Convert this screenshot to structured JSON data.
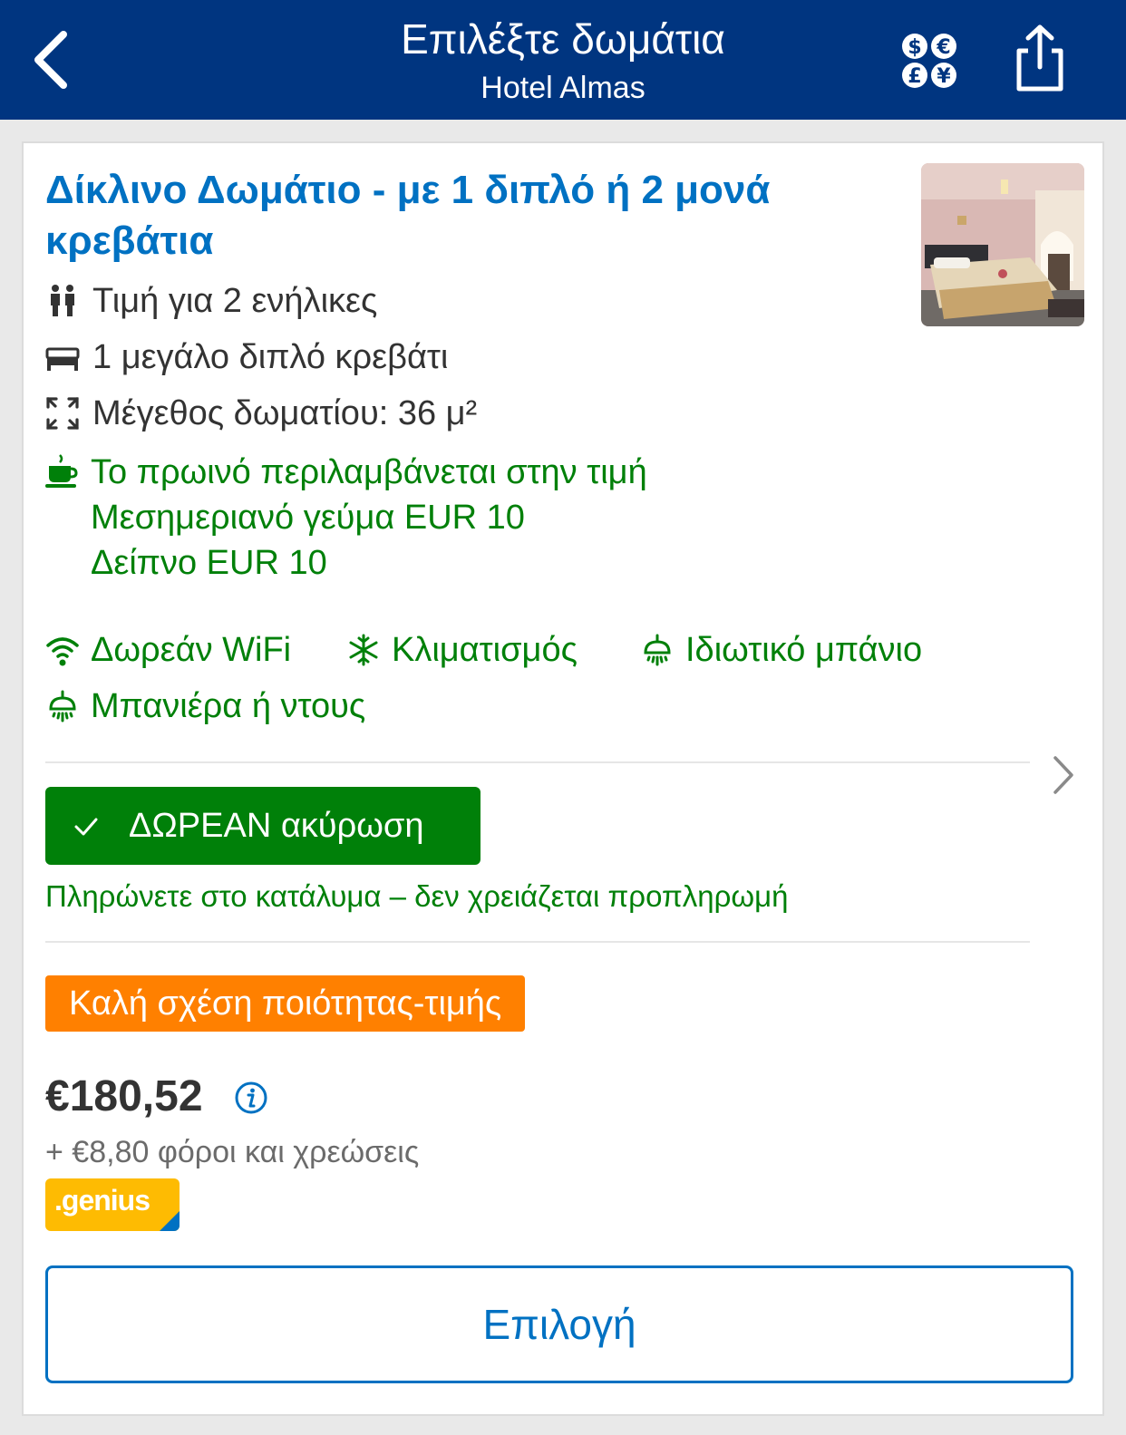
{
  "header": {
    "title": "Επιλέξτε δωμάτια",
    "subtitle": "Hotel Almas",
    "back_icon": "chevron-left-icon",
    "currency_icon": "currency-icon",
    "share_icon": "share-icon"
  },
  "room": {
    "title": "Δίκλινο Δωμάτιο - με 1 διπλό ή 2 μονά κρεβάτια",
    "occupancy": "Τιμή για 2 ενήλικες",
    "bed": "1 μεγάλο διπλό κρεβάτι",
    "size": "Μέγεθος δωματίου: 36 μ²",
    "meals": [
      "Το πρωινό περιλαμβάνεται στην τιμή",
      "Μεσημεριανό γεύμα EUR 10",
      "Δείπνο EUR 10"
    ],
    "facilities": [
      {
        "label": "Δωρεάν WiFi",
        "icon": "wifi-icon"
      },
      {
        "label": "Κλιματισμός",
        "icon": "snowflake-icon"
      },
      {
        "label": "Ιδιωτικό μπάνιο",
        "icon": "shower-icon"
      },
      {
        "label": "Μπανιέρα ή ντους",
        "icon": "shower-icon"
      }
    ]
  },
  "cancellation": {
    "label": "ΔΩΡΕΑΝ ακύρωση",
    "note": "Πληρώνετε στο κατάλυμα – δεν χρειάζεται προπληρωμή"
  },
  "badge": "Καλή σχέση ποιότητας-τιμής",
  "price": {
    "amount": "€180,52",
    "taxes": "+ €8,80 φόροι και χρεώσεις"
  },
  "genius": ".genius",
  "select_label": "Επιλογή",
  "colors": {
    "header": "#003580",
    "link_blue": "#0071c2",
    "green": "#008009",
    "orange": "#ff8000",
    "genius_yellow": "#febb02"
  }
}
